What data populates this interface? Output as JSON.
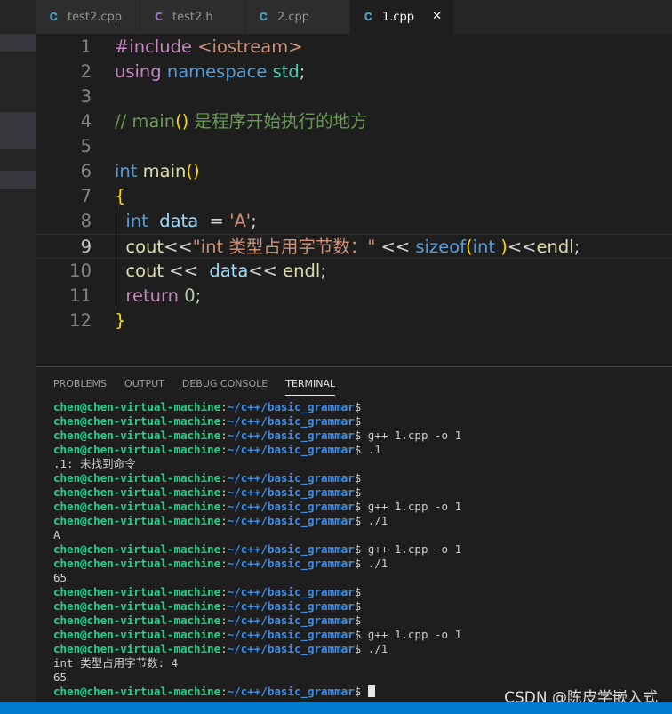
{
  "colors": {
    "keyword": "#569cd6",
    "control": "#c586c0",
    "string": "#ce9178",
    "comment": "#6a9955",
    "func": "#dcdcaa",
    "type": "#4ec9b0",
    "var": "#9cdcfe",
    "number": "#b5cea8",
    "bracket": "#ffd700",
    "prompt_user": "#23d18b",
    "prompt_path": "#3b8eea"
  },
  "tabs": [
    {
      "label": "test2.cpp",
      "icon": "C++ file icon"
    },
    {
      "label": "test2.h",
      "icon": "C header file icon"
    },
    {
      "label": "2.cpp",
      "icon": "C++ file icon"
    },
    {
      "label": "1.cpp",
      "icon": "C++ file icon",
      "active": true,
      "close": "✕"
    }
  ],
  "editor": {
    "line_numbers": [
      "1",
      "2",
      "3",
      "4",
      "5",
      "6",
      "7",
      "8",
      "9",
      "10",
      "11",
      "12"
    ],
    "current_line": 9,
    "lines": [
      [
        {
          "t": "#include ",
          "c": "control"
        },
        {
          "t": "<iostream>",
          "c": "string"
        }
      ],
      [
        {
          "t": "using ",
          "c": "control"
        },
        {
          "t": "namespace ",
          "c": "keyword"
        },
        {
          "t": "std",
          "c": "type"
        },
        {
          "t": ";",
          "c": "plain"
        }
      ],
      [],
      [
        {
          "t": "// main",
          "c": "comment"
        },
        {
          "t": "()",
          "c": "bracket"
        },
        {
          "t": " 是程序开始执行的地方",
          "c": "comment"
        }
      ],
      [],
      [
        {
          "t": "int ",
          "c": "keyword"
        },
        {
          "t": "main",
          "c": "func"
        },
        {
          "t": "()",
          "c": "bracket"
        }
      ],
      [
        {
          "t": "{",
          "c": "bracket"
        }
      ],
      [
        {
          "t": "  int ",
          "c": "keyword"
        },
        {
          "t": " data ",
          "c": "var"
        },
        {
          "t": " = ",
          "c": "plain"
        },
        {
          "t": "'A'",
          "c": "string"
        },
        {
          "t": ";",
          "c": "plain"
        }
      ],
      [
        {
          "t": "  cout",
          "c": "func"
        },
        {
          "t": "<<",
          "c": "plain"
        },
        {
          "t": "\"int 类型占用字节数：\"",
          "c": "string"
        },
        {
          "t": " << ",
          "c": "plain"
        },
        {
          "t": "sizeof",
          "c": "keyword"
        },
        {
          "t": "(",
          "c": "bracket"
        },
        {
          "t": "int ",
          "c": "keyword"
        },
        {
          "t": ")",
          "c": "bracket"
        },
        {
          "t": "<<",
          "c": "plain"
        },
        {
          "t": "endl",
          "c": "func"
        },
        {
          "t": ";",
          "c": "plain"
        }
      ],
      [
        {
          "t": "  cout",
          "c": "func"
        },
        {
          "t": " <<  ",
          "c": "plain"
        },
        {
          "t": "data",
          "c": "var"
        },
        {
          "t": "<< ",
          "c": "plain"
        },
        {
          "t": "endl",
          "c": "func"
        },
        {
          "t": ";",
          "c": "plain"
        }
      ],
      [
        {
          "t": "  return ",
          "c": "control"
        },
        {
          "t": "0",
          "c": "number"
        },
        {
          "t": ";",
          "c": "plain"
        }
      ],
      [
        {
          "t": "}",
          "c": "bracket"
        }
      ]
    ]
  },
  "panel": {
    "tabs": [
      "PROBLEMS",
      "OUTPUT",
      "DEBUG CONSOLE",
      "TERMINAL"
    ],
    "active_tab": "TERMINAL",
    "prompt_user": "chen@chen-virtual-machine",
    "prompt_path": "~/c++/basic_grammar",
    "terminal": [
      {
        "p": true,
        "cmd": ""
      },
      {
        "p": true,
        "cmd": ""
      },
      {
        "p": true,
        "cmd": " g++ 1.cpp -o 1"
      },
      {
        "p": true,
        "cmd": " .1"
      },
      {
        "p": false,
        "text": ".1: 未找到命令"
      },
      {
        "p": true,
        "cmd": ""
      },
      {
        "p": true,
        "cmd": ""
      },
      {
        "p": true,
        "cmd": " g++ 1.cpp -o 1"
      },
      {
        "p": true,
        "cmd": " ./1"
      },
      {
        "p": false,
        "text": "A"
      },
      {
        "p": true,
        "cmd": " g++ 1.cpp -o 1"
      },
      {
        "p": true,
        "cmd": " ./1"
      },
      {
        "p": false,
        "text": "65"
      },
      {
        "p": true,
        "cmd": ""
      },
      {
        "p": true,
        "cmd": ""
      },
      {
        "p": true,
        "cmd": ""
      },
      {
        "p": true,
        "cmd": " g++ 1.cpp -o 1"
      },
      {
        "p": true,
        "cmd": " ./1"
      },
      {
        "p": false,
        "text": "int 类型占用字节数: 4"
      },
      {
        "p": false,
        "text": "65"
      },
      {
        "p": true,
        "cmd": " ",
        "cursor": true
      }
    ]
  },
  "watermark": "CSDN @陈皮学嵌入式"
}
